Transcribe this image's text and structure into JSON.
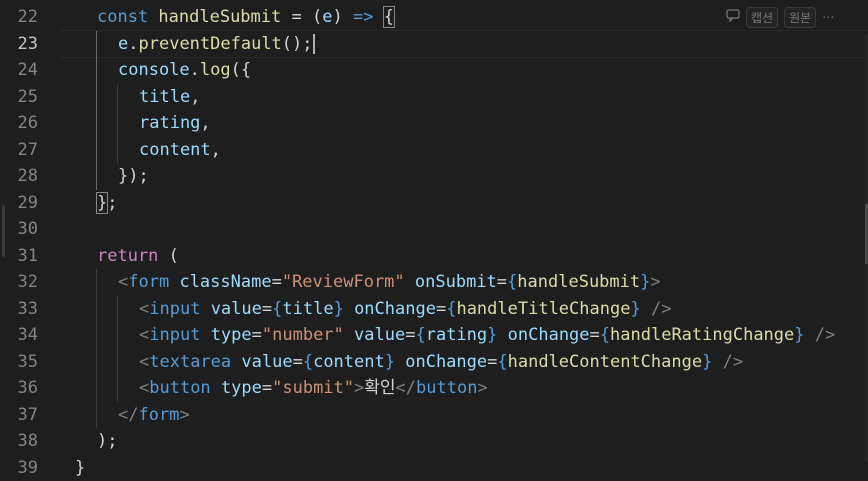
{
  "editor": {
    "active_line": "23",
    "lines": [
      {
        "num": "22",
        "indent": 1,
        "tokens": [
          {
            "c": "t-kw",
            "v": "const "
          },
          {
            "c": "t-fn",
            "v": "handleSubmit"
          },
          {
            "c": "t-plain",
            "v": " = "
          },
          {
            "c": "t-plain",
            "v": "("
          },
          {
            "c": "t-var",
            "v": "e"
          },
          {
            "c": "t-plain",
            "v": ") "
          },
          {
            "c": "t-kw",
            "v": "=>"
          },
          {
            "c": "t-plain",
            "v": " "
          },
          {
            "c": "t-plain bm",
            "v": "{"
          }
        ]
      },
      {
        "num": "23",
        "indent": 2,
        "cursor": true,
        "tokens": [
          {
            "c": "t-var",
            "v": "e"
          },
          {
            "c": "t-plain",
            "v": "."
          },
          {
            "c": "t-fn",
            "v": "preventDefault"
          },
          {
            "c": "t-plain",
            "v": "();"
          }
        ]
      },
      {
        "num": "24",
        "indent": 2,
        "tokens": [
          {
            "c": "t-var",
            "v": "console"
          },
          {
            "c": "t-plain",
            "v": "."
          },
          {
            "c": "t-fn",
            "v": "log"
          },
          {
            "c": "t-plain",
            "v": "({"
          }
        ]
      },
      {
        "num": "25",
        "indent": 3,
        "tokens": [
          {
            "c": "t-var",
            "v": "title"
          },
          {
            "c": "t-plain",
            "v": ","
          }
        ]
      },
      {
        "num": "26",
        "indent": 3,
        "tokens": [
          {
            "c": "t-var",
            "v": "rating"
          },
          {
            "c": "t-plain",
            "v": ","
          }
        ]
      },
      {
        "num": "27",
        "indent": 3,
        "tokens": [
          {
            "c": "t-var",
            "v": "content"
          },
          {
            "c": "t-plain",
            "v": ","
          }
        ]
      },
      {
        "num": "28",
        "indent": 2,
        "tokens": [
          {
            "c": "t-plain",
            "v": "});"
          }
        ]
      },
      {
        "num": "29",
        "indent": 1,
        "tokens": [
          {
            "c": "t-plain bm",
            "v": "}"
          },
          {
            "c": "t-plain",
            "v": ";"
          }
        ]
      },
      {
        "num": "30",
        "indent": 0,
        "tokens": []
      },
      {
        "num": "31",
        "indent": 1,
        "tokens": [
          {
            "c": "t-kw2",
            "v": "return"
          },
          {
            "c": "t-plain",
            "v": " ("
          }
        ]
      },
      {
        "num": "32",
        "indent": 2,
        "tokens": [
          {
            "c": "t-punc",
            "v": "<"
          },
          {
            "c": "t-tag",
            "v": "form"
          },
          {
            "c": "t-plain",
            "v": " "
          },
          {
            "c": "t-attr",
            "v": "className"
          },
          {
            "c": "t-plain",
            "v": "="
          },
          {
            "c": "t-str",
            "v": "\"ReviewForm\""
          },
          {
            "c": "t-plain",
            "v": " "
          },
          {
            "c": "t-attr",
            "v": "onSubmit"
          },
          {
            "c": "t-plain",
            "v": "="
          },
          {
            "c": "t-brace",
            "v": "{"
          },
          {
            "c": "t-fn",
            "v": "handleSubmit"
          },
          {
            "c": "t-brace",
            "v": "}"
          },
          {
            "c": "t-punc",
            "v": ">"
          }
        ]
      },
      {
        "num": "33",
        "indent": 3,
        "tokens": [
          {
            "c": "t-punc",
            "v": "<"
          },
          {
            "c": "t-tag",
            "v": "input"
          },
          {
            "c": "t-plain",
            "v": " "
          },
          {
            "c": "t-attr",
            "v": "value"
          },
          {
            "c": "t-plain",
            "v": "="
          },
          {
            "c": "t-brace",
            "v": "{"
          },
          {
            "c": "t-var",
            "v": "title"
          },
          {
            "c": "t-brace",
            "v": "}"
          },
          {
            "c": "t-plain",
            "v": " "
          },
          {
            "c": "t-attr",
            "v": "onChange"
          },
          {
            "c": "t-plain",
            "v": "="
          },
          {
            "c": "t-brace",
            "v": "{"
          },
          {
            "c": "t-fn",
            "v": "handleTitleChange"
          },
          {
            "c": "t-brace",
            "v": "}"
          },
          {
            "c": "t-plain",
            "v": " "
          },
          {
            "c": "t-punc",
            "v": "/>"
          }
        ]
      },
      {
        "num": "34",
        "indent": 3,
        "tokens": [
          {
            "c": "t-punc",
            "v": "<"
          },
          {
            "c": "t-tag",
            "v": "input"
          },
          {
            "c": "t-plain",
            "v": " "
          },
          {
            "c": "t-attr",
            "v": "type"
          },
          {
            "c": "t-plain",
            "v": "="
          },
          {
            "c": "t-str",
            "v": "\"number\""
          },
          {
            "c": "t-plain",
            "v": " "
          },
          {
            "c": "t-attr",
            "v": "value"
          },
          {
            "c": "t-plain",
            "v": "="
          },
          {
            "c": "t-brace",
            "v": "{"
          },
          {
            "c": "t-var",
            "v": "rating"
          },
          {
            "c": "t-brace",
            "v": "}"
          },
          {
            "c": "t-plain",
            "v": " "
          },
          {
            "c": "t-attr",
            "v": "onChange"
          },
          {
            "c": "t-plain",
            "v": "="
          },
          {
            "c": "t-brace",
            "v": "{"
          },
          {
            "c": "t-fn",
            "v": "handleRatingChange"
          },
          {
            "c": "t-brace",
            "v": "}"
          },
          {
            "c": "t-plain",
            "v": " "
          },
          {
            "c": "t-punc",
            "v": "/>"
          }
        ]
      },
      {
        "num": "35",
        "indent": 3,
        "tokens": [
          {
            "c": "t-punc",
            "v": "<"
          },
          {
            "c": "t-tag",
            "v": "textarea"
          },
          {
            "c": "t-plain",
            "v": " "
          },
          {
            "c": "t-attr",
            "v": "value"
          },
          {
            "c": "t-plain",
            "v": "="
          },
          {
            "c": "t-brace",
            "v": "{"
          },
          {
            "c": "t-var",
            "v": "content"
          },
          {
            "c": "t-brace",
            "v": "}"
          },
          {
            "c": "t-plain",
            "v": " "
          },
          {
            "c": "t-attr",
            "v": "onChange"
          },
          {
            "c": "t-plain",
            "v": "="
          },
          {
            "c": "t-brace",
            "v": "{"
          },
          {
            "c": "t-fn",
            "v": "handleContentChange"
          },
          {
            "c": "t-brace",
            "v": "}"
          },
          {
            "c": "t-plain",
            "v": " "
          },
          {
            "c": "t-punc",
            "v": "/>"
          }
        ]
      },
      {
        "num": "36",
        "indent": 3,
        "tokens": [
          {
            "c": "t-punc",
            "v": "<"
          },
          {
            "c": "t-tag",
            "v": "button"
          },
          {
            "c": "t-plain",
            "v": " "
          },
          {
            "c": "t-attr",
            "v": "type"
          },
          {
            "c": "t-plain",
            "v": "="
          },
          {
            "c": "t-str",
            "v": "\"submit\""
          },
          {
            "c": "t-punc",
            "v": ">"
          },
          {
            "c": "t-text",
            "v": "확인"
          },
          {
            "c": "t-punc",
            "v": "</"
          },
          {
            "c": "t-tag",
            "v": "button"
          },
          {
            "c": "t-punc",
            "v": ">"
          }
        ]
      },
      {
        "num": "37",
        "indent": 2,
        "tokens": [
          {
            "c": "t-punc",
            "v": "</"
          },
          {
            "c": "t-tag",
            "v": "form"
          },
          {
            "c": "t-punc",
            "v": ">"
          }
        ]
      },
      {
        "num": "38",
        "indent": 1,
        "tokens": [
          {
            "c": "t-plain",
            "v": ");"
          }
        ]
      },
      {
        "num": "39",
        "indent": 0,
        "tokens": [
          {
            "c": "t-plain",
            "v": "}"
          }
        ]
      }
    ]
  },
  "overlay": {
    "icon": "comment-icon",
    "caption_label": "캡션",
    "original_label": "원본",
    "more_icon": "more-icon"
  }
}
